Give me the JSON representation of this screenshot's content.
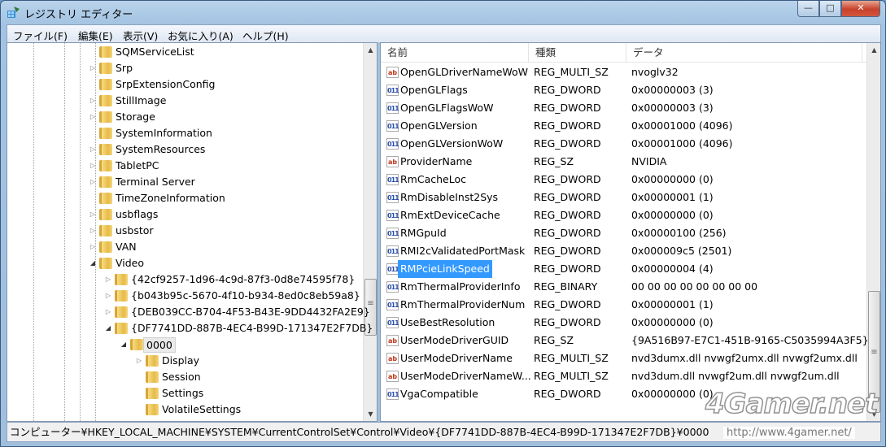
{
  "window": {
    "title": "レジストリ エディター",
    "min": "—",
    "max": "□",
    "close": "✕"
  },
  "menu": [
    "ファイル(F)",
    "編集(E)",
    "表示(V)",
    "お気に入り(A)",
    "ヘルプ(H)"
  ],
  "tree": [
    {
      "label": "SQMServiceList",
      "level": 0,
      "expander": ""
    },
    {
      "label": "Srp",
      "level": 0,
      "expander": "▷"
    },
    {
      "label": "SrpExtensionConfig",
      "level": 0,
      "expander": ""
    },
    {
      "label": "StillImage",
      "level": 0,
      "expander": "▷"
    },
    {
      "label": "Storage",
      "level": 0,
      "expander": "▷"
    },
    {
      "label": "SystemInformation",
      "level": 0,
      "expander": ""
    },
    {
      "label": "SystemResources",
      "level": 0,
      "expander": "▷"
    },
    {
      "label": "TabletPC",
      "level": 0,
      "expander": "▷"
    },
    {
      "label": "Terminal Server",
      "level": 0,
      "expander": "▷"
    },
    {
      "label": "TimeZoneInformation",
      "level": 0,
      "expander": ""
    },
    {
      "label": "usbflags",
      "level": 0,
      "expander": "▷"
    },
    {
      "label": "usbstor",
      "level": 0,
      "expander": "▷"
    },
    {
      "label": "VAN",
      "level": 0,
      "expander": "▷"
    },
    {
      "label": "Video",
      "level": 0,
      "expander": "◢"
    },
    {
      "label": "{42cf9257-1d96-4c9d-87f3-0d8e74595f78}",
      "level": 1,
      "expander": "▷"
    },
    {
      "label": "{b043b95c-5670-4f10-b934-8ed0c8eb59a8}",
      "level": 1,
      "expander": "▷"
    },
    {
      "label": "{DEB039CC-B704-4F53-B43E-9DD4432FA2E9}",
      "level": 1,
      "expander": "▷"
    },
    {
      "label": "{DF7741DD-887B-4EC4-B99D-171347E2F7DB}",
      "level": 1,
      "expander": "◢"
    },
    {
      "label": "0000",
      "level": 2,
      "expander": "◢",
      "selected": true
    },
    {
      "label": "Display",
      "level": 3,
      "expander": "▷"
    },
    {
      "label": "Session",
      "level": 3,
      "expander": ""
    },
    {
      "label": "Settings",
      "level": 3,
      "expander": ""
    },
    {
      "label": "VolatileSettings",
      "level": 3,
      "expander": ""
    }
  ],
  "columns": {
    "name": "名前",
    "type": "種類",
    "data": "データ"
  },
  "values": [
    {
      "name": "OpenGLDriverNameWoW",
      "type": "REG_MULTI_SZ",
      "data": "nvoglv32",
      "icon": "ab"
    },
    {
      "name": "OpenGLFlags",
      "type": "REG_DWORD",
      "data": "0x00000003 (3)",
      "icon": "bin"
    },
    {
      "name": "OpenGLFlagsWoW",
      "type": "REG_DWORD",
      "data": "0x00000003 (3)",
      "icon": "bin"
    },
    {
      "name": "OpenGLVersion",
      "type": "REG_DWORD",
      "data": "0x00001000 (4096)",
      "icon": "bin"
    },
    {
      "name": "OpenGLVersionWoW",
      "type": "REG_DWORD",
      "data": "0x00001000 (4096)",
      "icon": "bin"
    },
    {
      "name": "ProviderName",
      "type": "REG_SZ",
      "data": "NVIDIA",
      "icon": "ab"
    },
    {
      "name": "RmCacheLoc",
      "type": "REG_DWORD",
      "data": "0x00000000 (0)",
      "icon": "bin"
    },
    {
      "name": "RmDisableInst2Sys",
      "type": "REG_DWORD",
      "data": "0x00000001 (1)",
      "icon": "bin"
    },
    {
      "name": "RmExtDeviceCache",
      "type": "REG_DWORD",
      "data": "0x00000000 (0)",
      "icon": "bin"
    },
    {
      "name": "RMGpuId",
      "type": "REG_DWORD",
      "data": "0x00000100 (256)",
      "icon": "bin"
    },
    {
      "name": "RMI2cValidatedPortMask",
      "type": "REG_DWORD",
      "data": "0x000009c5 (2501)",
      "icon": "bin"
    },
    {
      "name": "RMPcieLinkSpeed",
      "type": "REG_DWORD",
      "data": "0x00000004 (4)",
      "icon": "bin",
      "selected": true
    },
    {
      "name": "RmThermalProviderInfo",
      "type": "REG_BINARY",
      "data": "00 00 00 00 00 00 00 00",
      "icon": "bin"
    },
    {
      "name": "RmThermalProviderNum",
      "type": "REG_DWORD",
      "data": "0x00000001 (1)",
      "icon": "bin"
    },
    {
      "name": "UseBestResolution",
      "type": "REG_DWORD",
      "data": "0x00000000 (0)",
      "icon": "bin"
    },
    {
      "name": "UserModeDriverGUID",
      "type": "REG_SZ",
      "data": "{9A516B97-E7C1-451B-9165-C5035994A3F5}",
      "icon": "ab"
    },
    {
      "name": "UserModeDriverName",
      "type": "REG_MULTI_SZ",
      "data": "nvd3dumx.dll nvwgf2umx.dll nvwgf2umx.dll",
      "icon": "ab"
    },
    {
      "name": "UserModeDriverNameW...",
      "type": "REG_MULTI_SZ",
      "data": "nvd3dum.dll nvwgf2um.dll nvwgf2um.dll",
      "icon": "ab"
    },
    {
      "name": "VgaCompatible",
      "type": "REG_DWORD",
      "data": "0x00000000 (0)",
      "icon": "bin"
    }
  ],
  "status": "コンピューター¥HKEY_LOCAL_MACHINE¥SYSTEM¥CurrentControlSet¥Control¥Video¥{DF7741DD-887B-4EC4-B99D-171347E2F7DB}¥0000",
  "watermark": {
    "logo": "4Gamer.net",
    "url": "http://www.4gamer.net/"
  }
}
